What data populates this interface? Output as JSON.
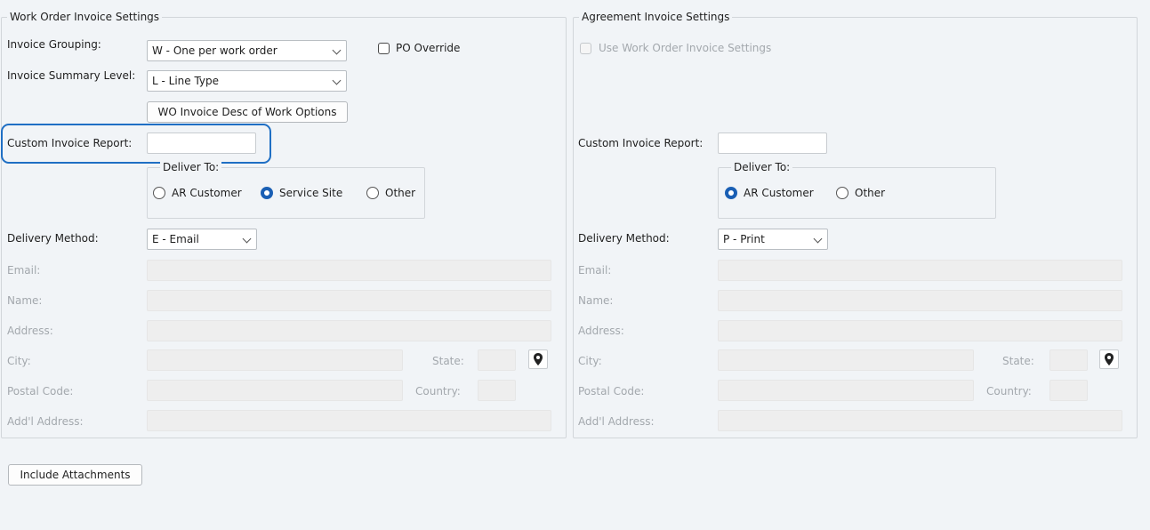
{
  "wo": {
    "legend": "Work Order Invoice Settings",
    "invoice_grouping_label": "Invoice Grouping:",
    "invoice_grouping_value": "W - One per work order",
    "po_override_label": "PO Override",
    "summary_level_label": "Invoice Summary Level:",
    "summary_level_value": "L - Line Type",
    "desc_button": "WO Invoice Desc of Work Options",
    "custom_report_label": "Custom Invoice Report:",
    "deliver_to_legend": "Deliver To:",
    "deliver_ar": "AR Customer",
    "deliver_site": "Service Site",
    "deliver_other": "Other",
    "delivery_method_label": "Delivery Method:",
    "delivery_method_value": "E - Email",
    "email_label": "Email:",
    "name_label": "Name:",
    "address_label": "Address:",
    "city_label": "City:",
    "state_label": "State:",
    "postal_label": "Postal Code:",
    "country_label": "Country:",
    "addl_label": "Add'l Address:"
  },
  "ag": {
    "legend": "Agreement Invoice Settings",
    "use_wo_label": "Use Work Order Invoice Settings",
    "custom_report_label": "Custom Invoice Report:",
    "deliver_to_legend": "Deliver To:",
    "deliver_ar": "AR Customer",
    "deliver_other": "Other",
    "delivery_method_label": "Delivery Method:",
    "delivery_method_value": "P - Print",
    "email_label": "Email:",
    "name_label": "Name:",
    "address_label": "Address:",
    "city_label": "City:",
    "state_label": "State:",
    "postal_label": "Postal Code:",
    "country_label": "Country:",
    "addl_label": "Add'l Address:"
  },
  "include_attachments": "Include Attachments",
  "colors": {
    "accent": "#1a5fb4",
    "highlight": "#1f6fc4",
    "background": "#f1f4f7"
  },
  "icons": {
    "map_pin": "map-pin-icon"
  }
}
